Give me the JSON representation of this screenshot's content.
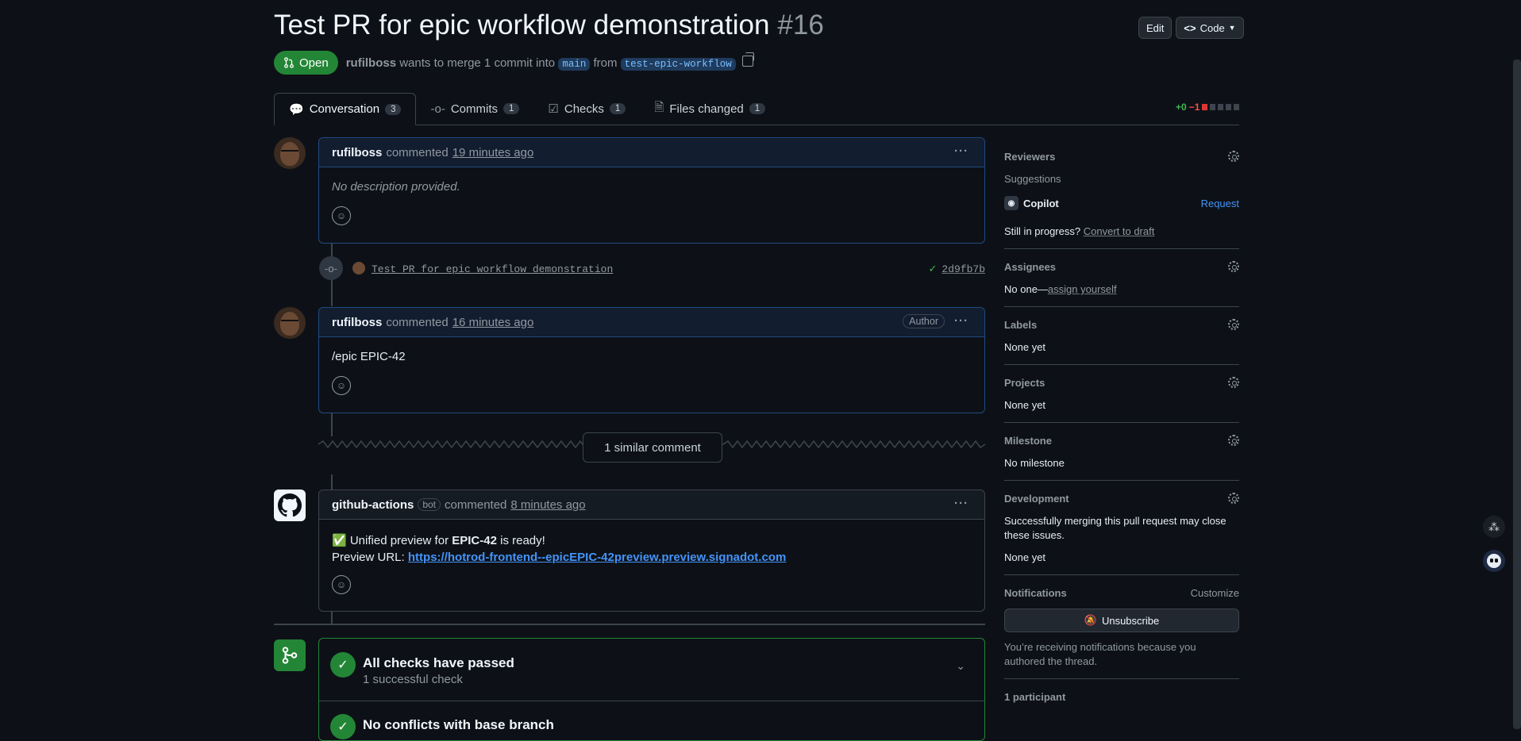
{
  "pr": {
    "title": "Test PR for epic workflow demonstration",
    "number": "#16",
    "state": "Open",
    "author": "rufilboss",
    "merge_text": "wants to merge 1 commit into",
    "base_branch": "main",
    "from_text": "from",
    "head_branch": "test-epic-workflow"
  },
  "header_buttons": {
    "edit": "Edit",
    "code": "Code"
  },
  "tabs": [
    {
      "label": "Conversation",
      "count": "3"
    },
    {
      "label": "Commits",
      "count": "1"
    },
    {
      "label": "Checks",
      "count": "1"
    },
    {
      "label": "Files changed",
      "count": "1"
    }
  ],
  "diffstat": {
    "additions": "+0",
    "deletions": "−1"
  },
  "comments": [
    {
      "author": "rufilboss",
      "action": "commented",
      "date": "19 minutes ago",
      "body": "No description provided."
    },
    {
      "author": "rufilboss",
      "action": "commented",
      "date": "16 minutes ago",
      "badge": "Author",
      "body": "/epic EPIC-42"
    },
    {
      "author": "github-actions",
      "bot": "bot",
      "action": "commented",
      "date": "8 minutes ago",
      "line1_prefix": "✅ Unified preview for",
      "line1_bold": "EPIC-42",
      "line1_suffix": "is ready!",
      "line2_prefix": "Preview URL:",
      "url": "https://hotrod-frontend--epicEPIC-42preview.preview.signadot.com"
    }
  ],
  "commit": {
    "message": "Test PR for epic workflow demonstration",
    "sha": "2d9fb7b"
  },
  "similar": "1 similar comment",
  "merge_box": {
    "checks_title": "All checks have passed",
    "checks_sub": "1 successful check",
    "conflicts_title": "No conflicts with base branch"
  },
  "sidebar": {
    "reviewers": {
      "title": "Reviewers",
      "suggestions": "Suggestions",
      "copilot": "Copilot",
      "request": "Request",
      "progress": "Still in progress?",
      "draft": "Convert to draft"
    },
    "assignees": {
      "title": "Assignees",
      "none": "No one—",
      "assign": "assign yourself"
    },
    "labels": {
      "title": "Labels",
      "value": "None yet"
    },
    "projects": {
      "title": "Projects",
      "value": "None yet"
    },
    "milestone": {
      "title": "Milestone",
      "value": "No milestone"
    },
    "development": {
      "title": "Development",
      "desc": "Successfully merging this pull request may close these issues.",
      "value": "None yet"
    },
    "notifications": {
      "title": "Notifications",
      "customize": "Customize",
      "unsubscribe": "Unsubscribe",
      "desc": "You’re receiving notifications because you authored the thread."
    },
    "participants": "1 participant"
  },
  "colors": {
    "accent": "#4493f8",
    "success": "#238636",
    "bg": "#0d1117"
  }
}
